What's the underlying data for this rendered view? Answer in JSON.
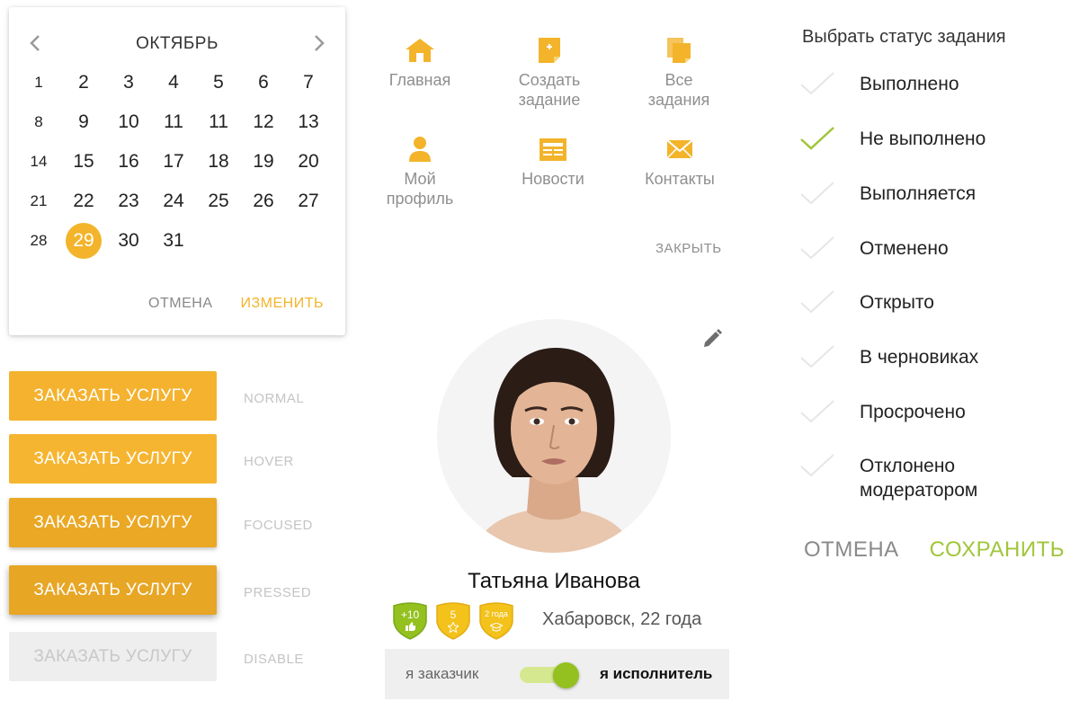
{
  "calendar": {
    "month": "ОКТЯБРЬ",
    "prev_icon": "chevron-left-icon",
    "next_icon": "chevron-right-icon",
    "weeks": [
      {
        "week": "1",
        "days": [
          "2",
          "3",
          "4",
          "5",
          "6",
          "7"
        ]
      },
      {
        "week": "8",
        "days": [
          "9",
          "10",
          "11",
          "11",
          "12",
          "13"
        ]
      },
      {
        "week": "14",
        "days": [
          "15",
          "16",
          "17",
          "18",
          "19",
          "20"
        ]
      },
      {
        "week": "21",
        "days": [
          "22",
          "23",
          "24",
          "25",
          "26",
          "27"
        ]
      },
      {
        "week": "28",
        "days": [
          "29",
          "30",
          "31"
        ]
      }
    ],
    "selected_day": "29",
    "cancel_label": "ОТМЕНА",
    "change_label": "ИЗМЕНИТЬ",
    "accent_color": "#f3b42b"
  },
  "order_buttons": [
    {
      "label": "ЗАКАЗАТЬ УСЛУГУ",
      "state": "NORMAL"
    },
    {
      "label": "ЗАКАЗАТЬ УСЛУГУ",
      "state": "HOVER"
    },
    {
      "label": "ЗАКАЗАТЬ УСЛУГУ",
      "state": "FOCUSED"
    },
    {
      "label": "ЗАКАЗАТЬ УСЛУГУ",
      "state": "PRESSED"
    },
    {
      "label": "ЗАКАЗАТЬ УСЛУГУ",
      "state": "DISABLE"
    }
  ],
  "menu": {
    "items": [
      {
        "label": "Главная",
        "icon": "home-icon"
      },
      {
        "label": "Создать\nзадание",
        "icon": "create-task-icon"
      },
      {
        "label": "Все\nзадания",
        "icon": "all-tasks-icon"
      },
      {
        "label": "Мой\nпрофиль",
        "icon": "user-icon"
      },
      {
        "label": "Новости",
        "icon": "news-icon"
      },
      {
        "label": "Контакты",
        "icon": "envelope-icon"
      }
    ],
    "close_label": "ЗАКРЫТЬ",
    "icon_color": "#f3b42b"
  },
  "profile": {
    "name": "Татьяна Иванова",
    "location": "Хабаровск, 22 года",
    "badges": [
      {
        "text": "+10",
        "icon": "thumbs-up-icon",
        "color": "#94c11f"
      },
      {
        "text": "5",
        "icon": "star-icon",
        "color": "#f3c21b"
      },
      {
        "text": "2 года",
        "icon": "graduation-cap-icon",
        "color": "#f3c21b"
      }
    ],
    "role_left": "я заказчик",
    "role_right": "я исполнитель",
    "switch_color": "#94c11f"
  },
  "status": {
    "title": "Выбрать статус задания",
    "items": [
      {
        "label": "Выполнено",
        "checked": false
      },
      {
        "label": "Не выполнено",
        "checked": true
      },
      {
        "label": "Выполняется",
        "checked": false
      },
      {
        "label": "Отменено",
        "checked": false
      },
      {
        "label": "Открыто",
        "checked": false
      },
      {
        "label": "В черновиках",
        "checked": false
      },
      {
        "label": "Просрочено",
        "checked": false
      },
      {
        "label": "Отклонено\nмодератором",
        "checked": false
      }
    ],
    "cancel_label": "ОТМЕНА",
    "save_label": "СОХРАНИТЬ",
    "check_color": "#a0c63a"
  }
}
